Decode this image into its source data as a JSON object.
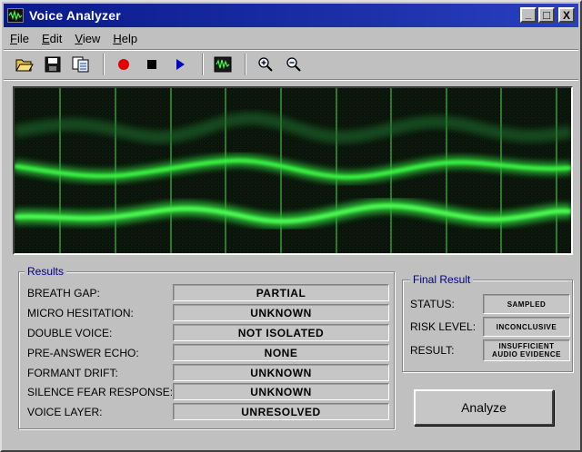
{
  "window": {
    "title": "Voice Analyzer"
  },
  "title_buttons": {
    "minimize": "_",
    "maximize": "□",
    "close": "X"
  },
  "menu": [
    {
      "label": "File",
      "mnemonic": "F",
      "rest": "ile"
    },
    {
      "label": "Edit",
      "mnemonic": "E",
      "rest": "dit"
    },
    {
      "label": "View",
      "mnemonic": "V",
      "rest": "iew"
    },
    {
      "label": "Help",
      "mnemonic": "H",
      "rest": "elp"
    }
  ],
  "toolbar": {
    "icons": [
      "open-folder-icon",
      "save-icon",
      "copy-icon",
      "record-icon",
      "stop-icon",
      "play-icon",
      "waveform-icon",
      "zoom-in-icon",
      "zoom-out-icon"
    ]
  },
  "colors": {
    "title_bar": "#0a1a8c",
    "scope_background": "#000000",
    "waveform": "#35ff3a",
    "record": "#e00000",
    "play": "#0000c8",
    "group_title": "#000080"
  },
  "results": {
    "title": "Results",
    "rows": [
      {
        "label": "BREATH GAP:",
        "value": "PARTIAL"
      },
      {
        "label": "MICRO HESITATION:",
        "value": "UNKNOWN"
      },
      {
        "label": "DOUBLE VOICE:",
        "value": "NOT ISOLATED"
      },
      {
        "label": "PRE-ANSWER ECHO:",
        "value": "NONE"
      },
      {
        "label": "FORMANT DRIFT:",
        "value": "UNKNOWN"
      },
      {
        "label": "SILENCE FEAR RESPONSE:",
        "value": "UNKNOWN"
      },
      {
        "label": "VOICE LAYER:",
        "value": "UNRESOLVED"
      }
    ]
  },
  "final_result": {
    "title": "Final Result",
    "status": {
      "label": "STATUS:",
      "value": "SAMPLED"
    },
    "risk_level": {
      "label": "RISK LEVEL:",
      "value": "INCONCLUSIVE"
    },
    "result": {
      "label": "RESULT:",
      "value": "INSUFFICIENT AUDIO EVIDENCE"
    }
  },
  "analyze_button": {
    "label": "Analyze"
  }
}
